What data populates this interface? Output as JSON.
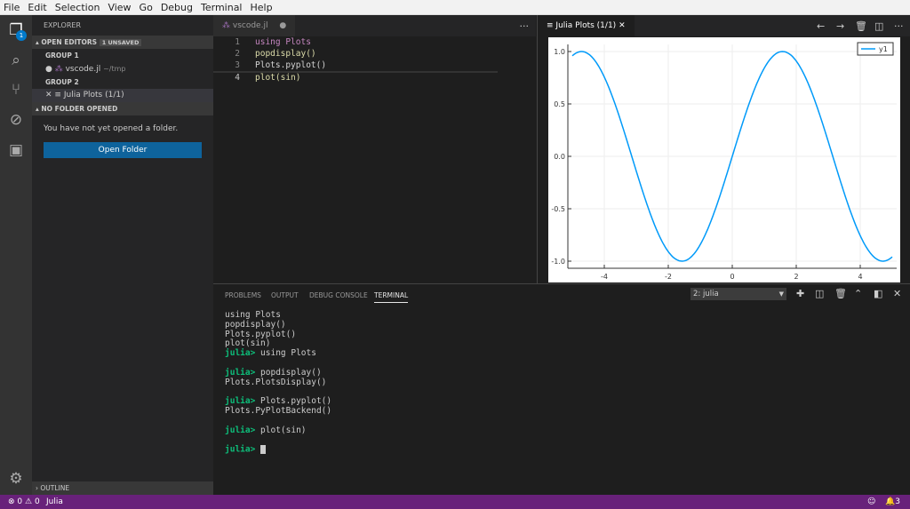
{
  "menu": [
    "File",
    "Edit",
    "Selection",
    "View",
    "Go",
    "Debug",
    "Terminal",
    "Help"
  ],
  "activity": {
    "badge": "1"
  },
  "sidebar": {
    "title": "EXPLORER",
    "open_editors": "OPEN EDITORS",
    "unsaved": "1 UNSAVED",
    "group1": "GROUP 1",
    "file1": "vscode.jl",
    "file1_path": "~/tmp",
    "group2": "GROUP 2",
    "file2": "Julia Plots (1/1)",
    "no_folder": "NO FOLDER OPENED",
    "message": "You have not yet opened a folder.",
    "open_folder": "Open Folder",
    "outline": "OUTLINE"
  },
  "editor": {
    "tab": "vscode.jl",
    "lines": [
      {
        "n": "1",
        "t": "using Plots"
      },
      {
        "n": "2",
        "t": "popdisplay()"
      },
      {
        "n": "3",
        "t": "Plots.pyplot()"
      },
      {
        "n": "4",
        "t": "plot(sin)"
      }
    ]
  },
  "plotpane": {
    "tab": "Julia Plots (1/1)"
  },
  "chart_data": {
    "type": "line",
    "function": "sin",
    "xlim": [
      -5,
      5
    ],
    "ylim": [
      -1,
      1
    ],
    "xticks": [
      "-4",
      "-2",
      "0",
      "2",
      "4"
    ],
    "yticks": [
      "1.0",
      "0.5",
      "0.0",
      "-0.5",
      "-1.0"
    ],
    "xtick_values": [
      -4,
      -2,
      0,
      2,
      4
    ],
    "ytick_values": [
      1,
      0.5,
      0,
      -0.5,
      -1
    ],
    "legend": "y1",
    "legend_position": "top-right",
    "grid": true,
    "color": "#009af9"
  },
  "panel": {
    "tabs": [
      "PROBLEMS",
      "OUTPUT",
      "DEBUG CONSOLE",
      "TERMINAL"
    ],
    "terminal_select": "2: julia",
    "terminal": [
      "using Plots",
      "popdisplay()",
      "Plots.pyplot()",
      "plot(sin)",
      {
        "p": "julia> ",
        "c": "using Plots"
      },
      "",
      {
        "p": "julia> ",
        "c": "popdisplay()"
      },
      "Plots.PlotsDisplay()",
      "",
      {
        "p": "julia> ",
        "c": "Plots.pyplot()"
      },
      "Plots.PyPlotBackend()",
      "",
      {
        "p": "julia> ",
        "c": "plot(sin)"
      },
      "",
      {
        "p": "julia> ",
        "c": ""
      }
    ]
  },
  "status": {
    "errors": "0",
    "warnings": "0",
    "language": "Julia",
    "notifications": "3",
    "color": "#68217a"
  }
}
